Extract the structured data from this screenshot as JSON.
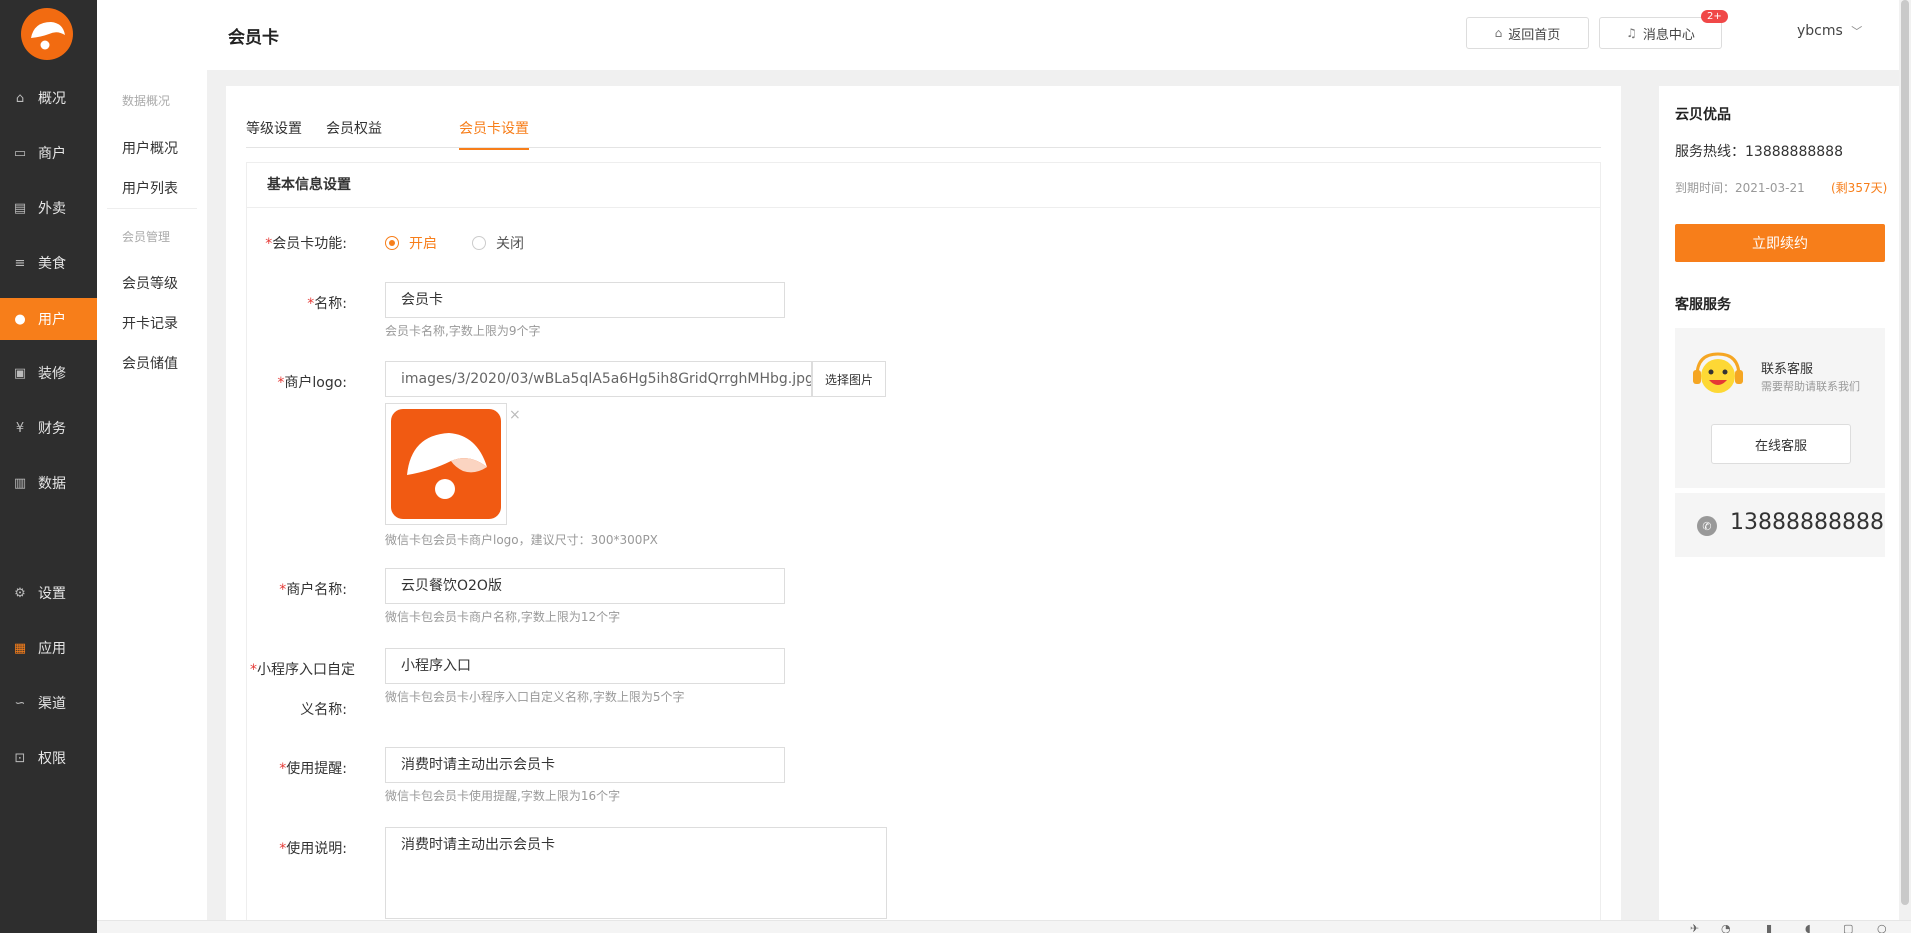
{
  "nav": {
    "items": [
      {
        "label": "概况",
        "icon": "home-icon",
        "glyph": "⌂"
      },
      {
        "label": "商户",
        "icon": "shop-icon",
        "glyph": "▭"
      },
      {
        "label": "外卖",
        "icon": "takeout-icon",
        "glyph": "▤"
      },
      {
        "label": "美食",
        "icon": "food-icon",
        "glyph": "≡"
      },
      {
        "label": "用户",
        "icon": "user-icon",
        "glyph": "●"
      },
      {
        "label": "装修",
        "icon": "decorate-icon",
        "glyph": "▣"
      },
      {
        "label": "财务",
        "icon": "finance-icon",
        "glyph": "¥"
      },
      {
        "label": "数据",
        "icon": "chart-icon",
        "glyph": "▥"
      },
      {
        "label": "设置",
        "icon": "gear-icon",
        "glyph": "⚙"
      },
      {
        "label": "应用",
        "icon": "apps-icon",
        "glyph": "▦"
      },
      {
        "label": "渠道",
        "icon": "link-icon",
        "glyph": "∽"
      },
      {
        "label": "权限",
        "icon": "lock-icon",
        "glyph": "⊡"
      }
    ],
    "active_index": 4
  },
  "subnav": {
    "group1": "数据概况",
    "link1": "用户概况",
    "link2": "用户列表",
    "group2": "会员管理",
    "link3": "会员等级",
    "link4": "开卡记录",
    "link5": "会员储值"
  },
  "header": {
    "title": "会员卡",
    "home_btn": "返回首页",
    "msg_btn": "消息中心",
    "msg_badge": "2+",
    "user": "ybcms",
    "user_caret": "﹀"
  },
  "tabs": [
    "等级设置",
    "会员权益",
    "会员卡设置"
  ],
  "form": {
    "section_title": "基本信息设置",
    "required_mark": "*",
    "card_fn_label": "会员卡功能:",
    "radio_on": "开启",
    "radio_off": "关闭",
    "name_label": "名称:",
    "name_value": "会员卡",
    "name_hint": "会员卡名称,字数上限为9个字",
    "logo_label": "商户logo:",
    "logo_value": "images/3/2020/03/wBLa5qlA5a6Hg5ih8GridQrrghMHbg.jpg",
    "logo_btn": "选择图片",
    "logo_close": "×",
    "logo_hint": "微信卡包会员卡商户logo，建议尺寸：300*300PX",
    "merchant_label": "商户名称:",
    "merchant_value": "云贝餐饮O2O版",
    "merchant_hint": "微信卡包会员卡商户名称,字数上限为12个字",
    "mini_label_1": "小程序入口自定",
    "mini_label_2": "义名称:",
    "mini_value": "小程序入口",
    "mini_hint": "微信卡包会员卡小程序入口自定义名称,字数上限为5个字",
    "remind_label": "使用提醒:",
    "remind_value": "消费时请主动出示会员卡",
    "remind_hint": "微信卡包会员卡使用提醒,字数上限为16个字",
    "desc_label": "使用说明:",
    "desc_value": "消费时请主动出示会员卡"
  },
  "right": {
    "title": "云贝优品",
    "hotline": "服务热线：13888888888",
    "expire": "到期时间：2021-03-21",
    "remain": "(剩357天)",
    "renew_btn": "立即续约",
    "service_title": "客服服务",
    "svc_name": "联系客服",
    "svc_desc": "需要帮助请联系我们",
    "svc_btn": "在线客服",
    "phone_glyph": "✆",
    "phone": "13888888888"
  },
  "bottom_icons": [
    "rocket-icon",
    "speed-icon",
    "trash-icon",
    "sound-icon",
    "window-icon",
    "search-icon"
  ],
  "colors": {
    "accent": "#f77e1a",
    "nav_bg": "#2e2e2e",
    "required": "#e53935"
  }
}
